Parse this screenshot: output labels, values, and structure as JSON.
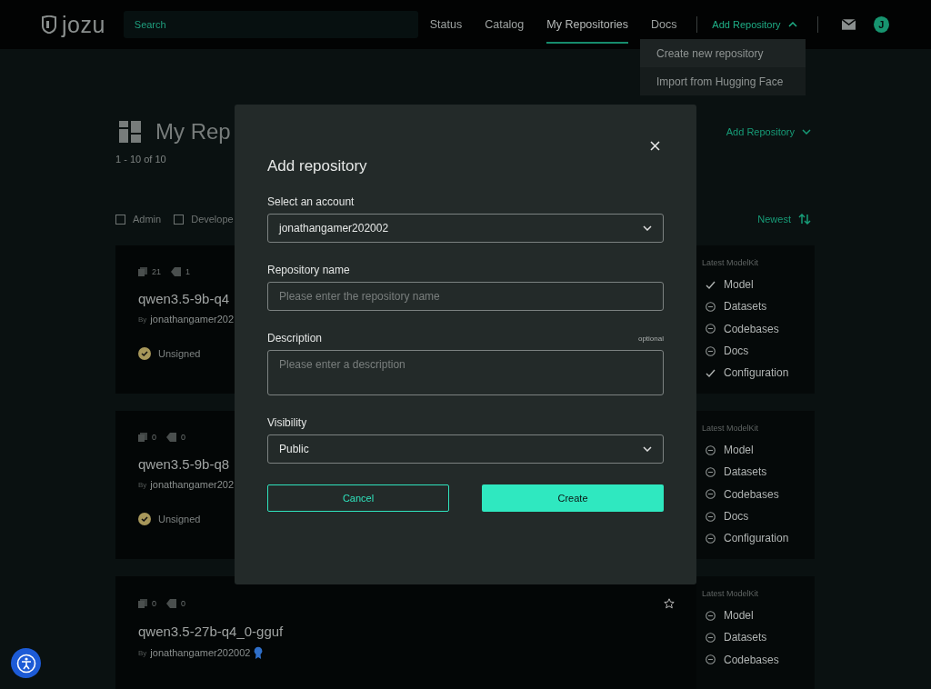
{
  "header": {
    "logo": "jozu",
    "search": {
      "placeholder": "Search"
    },
    "nav": [
      {
        "label": "Status",
        "selected": false
      },
      {
        "label": "Catalog",
        "selected": false
      },
      {
        "label": "My Repositories",
        "selected": true
      },
      {
        "label": "Docs",
        "selected": false
      }
    ],
    "add_menu": {
      "label": "Add Repository",
      "expanded": true,
      "items": [
        "Create new repository",
        "Import from Hugging Face"
      ]
    },
    "avatar": "J"
  },
  "page": {
    "title": "My Rep",
    "count": "1 - 10 of 10",
    "add_button": "Add Repository",
    "sort": "Newest",
    "filters": [
      {
        "label": "Admin",
        "checked": false
      },
      {
        "label": "Develope",
        "checked": false
      }
    ],
    "cards": [
      {
        "files": "21",
        "tags": "1",
        "name": "qwen3.5-9b-q4",
        "author_prefix": "By",
        "author": "jonathangamer202",
        "status": "Unsigned",
        "modelkit_title": "Latest ModelKit",
        "modelkit": [
          {
            "label": "Model",
            "included": true
          },
          {
            "label": "Datasets",
            "included": false
          },
          {
            "label": "Codebases",
            "included": false
          },
          {
            "label": "Docs",
            "included": false
          },
          {
            "label": "Configuration",
            "included": true
          }
        ]
      },
      {
        "files": "0",
        "tags": "0",
        "name": "qwen3.5-9b-q8",
        "author_prefix": "By",
        "author": "jonathangamer202",
        "status": "Unsigned",
        "modelkit_title": "Latest ModelKit",
        "modelkit": [
          {
            "label": "Model",
            "included": false
          },
          {
            "label": "Datasets",
            "included": false
          },
          {
            "label": "Codebases",
            "included": false
          },
          {
            "label": "Docs",
            "included": false
          },
          {
            "label": "Configuration",
            "included": false
          }
        ]
      },
      {
        "files": "0",
        "tags": "0",
        "name": "qwen3.5-27b-q4_0-gguf",
        "author_prefix": "By",
        "author": "jonathangamer202002",
        "verified": true,
        "starred": false,
        "modelkit_title": "Latest ModelKit",
        "modelkit": [
          {
            "label": "Model",
            "included": false
          },
          {
            "label": "Datasets",
            "included": false
          },
          {
            "label": "Codebases",
            "included": false
          }
        ]
      }
    ]
  },
  "dialog": {
    "title": "Add repository",
    "fields": [
      {
        "kind": "select",
        "label": "Select an account",
        "value": "jonathangamer202002"
      },
      {
        "kind": "text",
        "label": "Repository name",
        "placeholder": "Please enter the repository name"
      },
      {
        "kind": "textarea",
        "label": "Description",
        "note": "optional",
        "placeholder": "Please enter a description"
      },
      {
        "kind": "select",
        "label": "Visibility",
        "value": "Public"
      }
    ],
    "cancel": "Cancel",
    "submit": "Create"
  }
}
